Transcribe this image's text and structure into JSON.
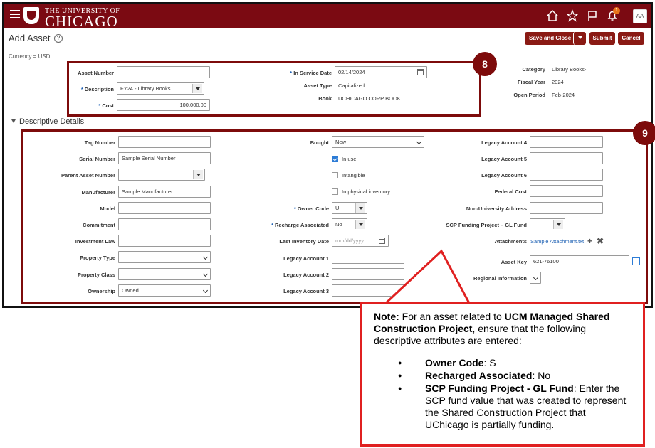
{
  "header": {
    "logo_line1": "THE UNIVERSITY OF",
    "logo_line2": "CHICAGO",
    "avatar": "AA",
    "notification_count": "1",
    "brand_color": "#7b0a12"
  },
  "page": {
    "title": "Add Asset",
    "currency": "Currency = USD",
    "buttons": {
      "save_close": "Save and Close",
      "submit": "Submit",
      "cancel": "Cancel"
    }
  },
  "asset_header": {
    "asset_number_label": "Asset Number",
    "asset_number_value": "",
    "description_label": "Description",
    "description_value": "FY24 - Library Books",
    "cost_label": "Cost",
    "cost_value": "100,000.00",
    "in_service_date_label": "In Service Date",
    "in_service_date_value": "02/14/2024",
    "asset_type_label": "Asset Type",
    "asset_type_value": "Capitalized",
    "book_label": "Book",
    "book_value": "UCHICAGO CORP BOOK",
    "category_label": "Category",
    "category_value": "Library Books-",
    "fiscal_year_label": "Fiscal Year",
    "fiscal_year_value": "2024",
    "open_period_label": "Open Period",
    "open_period_value": "Feb-2024"
  },
  "badges": {
    "b8": "8",
    "b9": "9"
  },
  "descriptive": {
    "section_title": "Descriptive Details",
    "col1": [
      {
        "label": "Tag Number",
        "value": "",
        "type": "text"
      },
      {
        "label": "Serial Number",
        "value": "Sample Serial Number",
        "type": "text"
      },
      {
        "label": "Parent Asset Number",
        "value": "",
        "type": "dropdown"
      },
      {
        "label": "Manufacturer",
        "value": "Sample Manufacturer",
        "type": "text"
      },
      {
        "label": "Model",
        "value": "",
        "type": "text"
      },
      {
        "label": "Commitment",
        "value": "",
        "type": "text"
      },
      {
        "label": "Investment Law",
        "value": "",
        "type": "text"
      },
      {
        "label": "Property Type",
        "value": "",
        "type": "select"
      },
      {
        "label": "Property Class",
        "value": "",
        "type": "select"
      },
      {
        "label": "Ownership",
        "value": "Owned",
        "type": "select"
      }
    ],
    "col2": {
      "bought_label": "Bought",
      "bought_value": "New",
      "in_use_label": "In use",
      "intangible_label": "Intangible",
      "physical_inventory_label": "In physical inventory",
      "owner_code_label": "Owner Code",
      "owner_code_value": "U",
      "recharge_label": "Recharge Associated",
      "recharge_value": "No",
      "last_inventory_label": "Last Inventory Date",
      "last_inventory_placeholder": "mm/dd/yyyy",
      "legacy1_label": "Legacy Account 1",
      "legacy2_label": "Legacy Account 2",
      "legacy3_label": "Legacy Account 3"
    },
    "col3": {
      "legacy4_label": "Legacy Account 4",
      "legacy5_label": "Legacy Account 5",
      "legacy6_label": "Legacy Account 6",
      "federal_cost_label": "Federal Cost",
      "non_univ_address_label": "Non-University Address",
      "scp_label": "SCP Funding Project – GL Fund",
      "attachments_label": "Attachments",
      "attachment_link": "Sample Attachment.txt",
      "asset_key_label": "Asset Key",
      "asset_key_value": "621-76100",
      "regional_info_label": "Regional Information"
    }
  },
  "callout": {
    "intro_bold1": "Note:",
    "intro_text1": " For an asset related to ",
    "intro_bold2": "UCM Managed Shared Construction Project",
    "intro_text2": ", ensure that the following descriptive attributes are entered:",
    "items": [
      {
        "bold": "Owner Code",
        "text": ": S"
      },
      {
        "bold": "Recharged Associated",
        "text": ": No"
      },
      {
        "bold": "SCP Funding Project - GL Fund",
        "text": ": Enter the SCP fund value that was created to represent the Shared Construction Project that UChicago is partially funding."
      }
    ]
  }
}
